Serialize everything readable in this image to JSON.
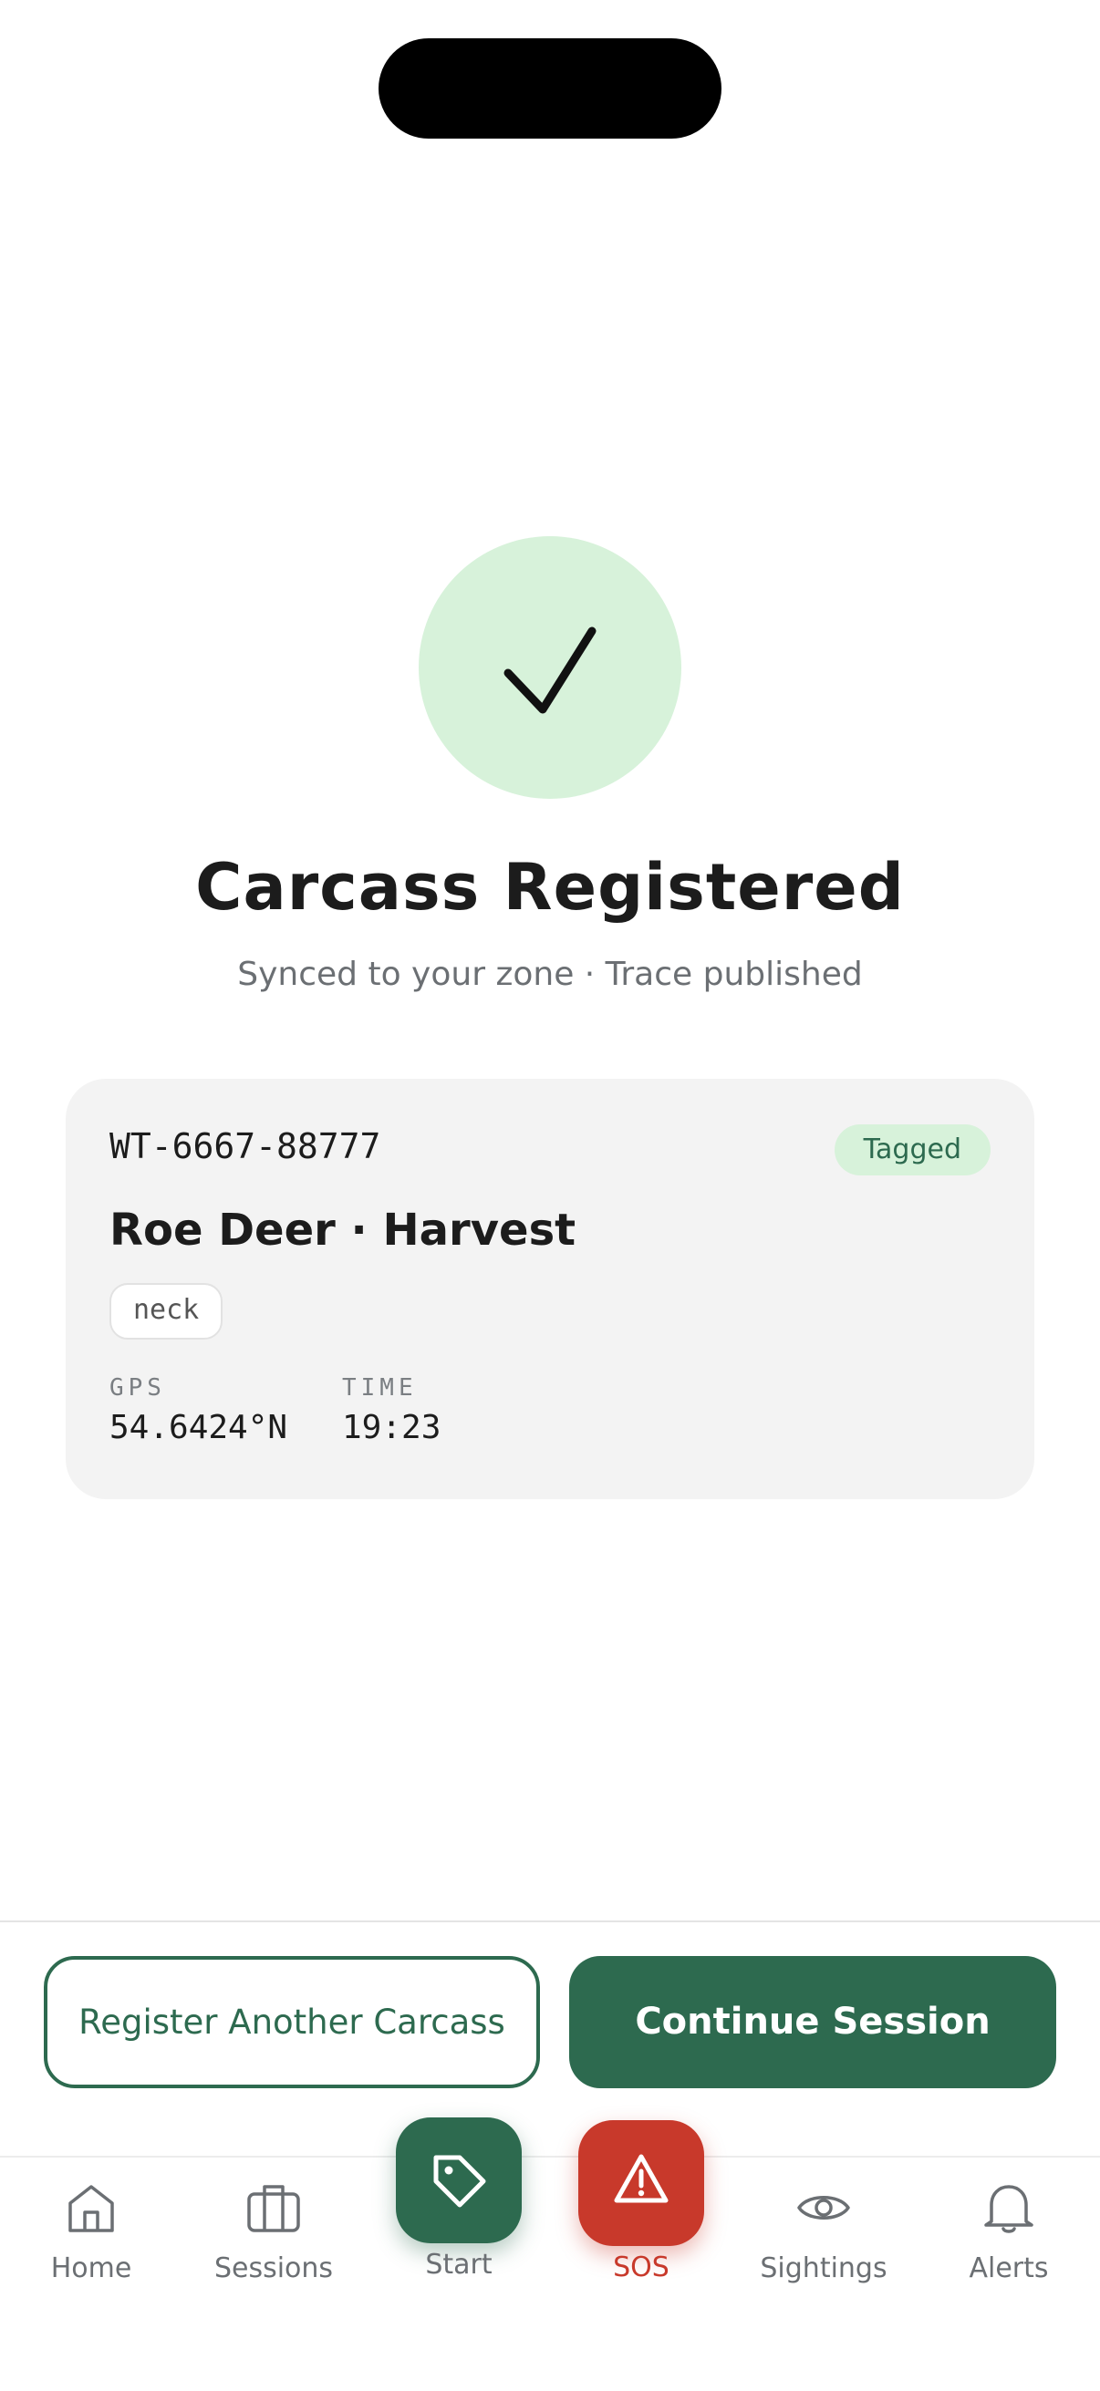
{
  "success": {
    "icon": "checkmark-icon",
    "title": "Carcass Registered",
    "subtitle": "Synced to your zone · Trace published"
  },
  "card": {
    "tag_id": "WT-6667-88777",
    "status": "Tagged",
    "animal": "Roe Deer · Harvest",
    "chip": "neck",
    "gps_label": "GPS",
    "gps_value": "54.6424°N",
    "time_label": "TIME",
    "time_value": "19:23"
  },
  "actions": {
    "register_another": "Register Another Carcass",
    "continue_session": "Continue Session"
  },
  "nav": {
    "home": "Home",
    "sessions": "Sessions",
    "start": "Start",
    "sos": "SOS",
    "sightings": "Sightings",
    "alerts": "Alerts"
  },
  "colors": {
    "brand_green": "#2d6a4f",
    "success_bg": "#d7f2da",
    "sos_red": "#c8392b"
  }
}
